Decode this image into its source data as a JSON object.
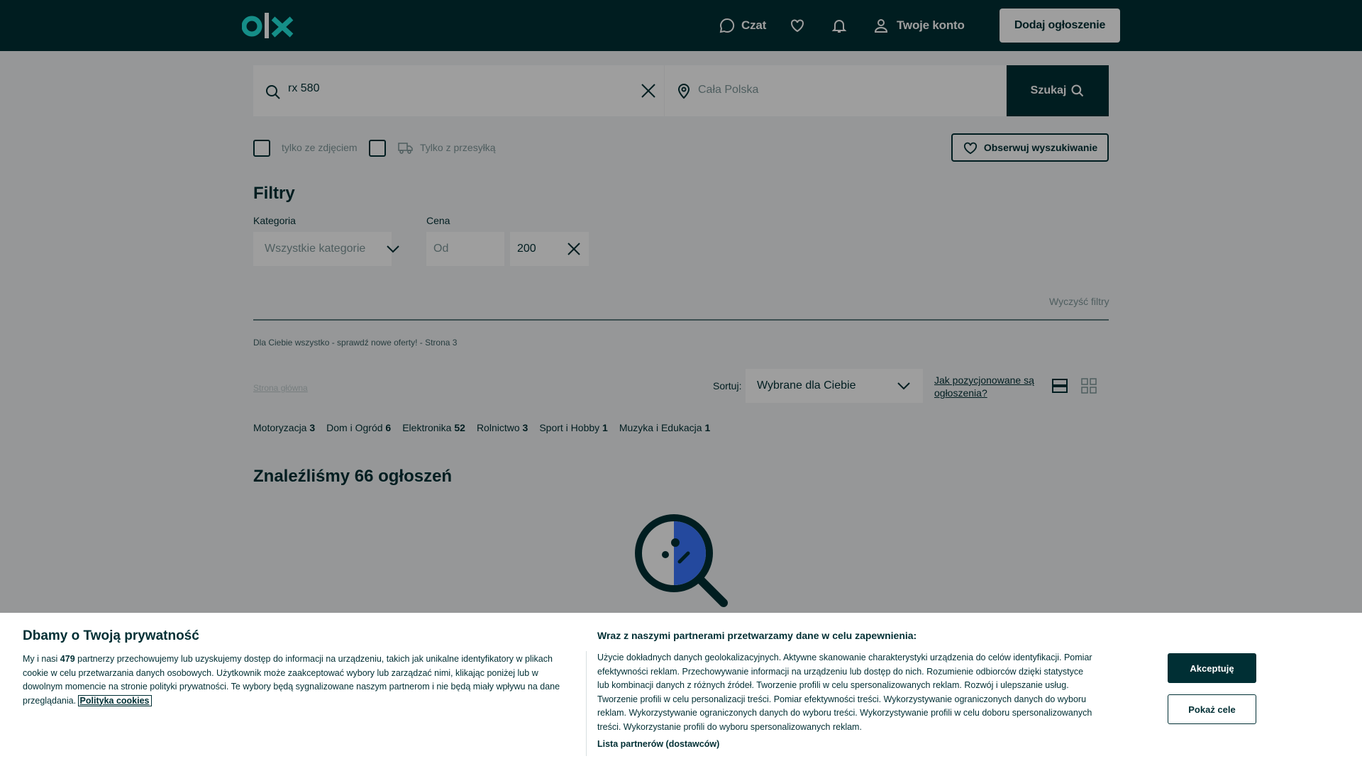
{
  "header": {
    "chat_label": "Czat",
    "account_label": "Twoje konto",
    "add_button": "Dodaj ogłoszenie",
    "colors": {
      "brand": "#002f34",
      "accent": "#23e5db"
    }
  },
  "search": {
    "query": "rx 580",
    "location": "Cała Polska",
    "button": "Szukaj"
  },
  "checkboxes": {
    "photos_label": "tylko ze zdjęciem",
    "delivery_label": "Tylko z przesyłką"
  },
  "observe_button": "Obserwuj wyszukiwanie",
  "filters": {
    "title": "Filtry",
    "category_label": "Kategoria",
    "category_value": "Wszystkie kategorie",
    "price_label": "Cena",
    "price_from_placeholder": "Od",
    "price_to_value": "200",
    "clear": "Wyczyść filtry"
  },
  "breadcrumb": {
    "text": "Dla Ciebie wszystko - sprawdź nowe oferty! - Strona 3",
    "home": "Strona główna"
  },
  "sort": {
    "label": "Sortuj:",
    "value": "Wybrane dla Ciebie",
    "how_link": "Jak pozycjonowane są ogłoszenia?"
  },
  "categories": [
    {
      "name": "Motoryzacja",
      "count": "3"
    },
    {
      "name": "Dom i Ogród",
      "count": "6"
    },
    {
      "name": "Elektronika",
      "count": "52"
    },
    {
      "name": "Rolnictwo",
      "count": "3"
    },
    {
      "name": "Sport i Hobby",
      "count": "1"
    },
    {
      "name": "Muzyka i Edukacja",
      "count": "1"
    }
  ],
  "results_title": "Znaleźliśmy 66 ogłoszeń",
  "cookie": {
    "title": "Dbamy o Twoją prywatność",
    "text_pre": "My i nasi ",
    "partners_count": "479",
    "text_post": " partnerzy przechowujemy lub uzyskujemy dostęp do informacji na urządzeniu, takich jak unikalne identyfikatory w plikach cookie w celu przetwarzania danych osobowych. Użytkownik może zaakceptować wybory lub zarządzać nimi, klikając poniżej lub w dowolnym momencie na stronie polityki prywatności. Te wybory będą sygnalizowane naszym partnerom i nie będą miały wpływu na dane przeglądania. ",
    "policy_link": "Polityka cookies",
    "purposes_title": "Wraz z naszymi partnerami przetwarzamy dane w celu zapewnienia:",
    "purposes_text": "Użycie dokładnych danych geolokalizacyjnych. Aktywne skanowanie charakterystyki urządzenia do celów identyfikacji. Pomiar efektywności reklam. Przechowywanie informacji na urządzeniu lub dostęp do nich. Rozumienie odbiorców dzięki statystyce lub kombinacji danych z różnych źródeł. Tworzenie profili w celu spersonalizowanych reklam. Rozwój i ulepszanie usług. Tworzenie profili w celu personalizacji treści. Pomiar efektywności treści. Wykorzystywanie ograniczonych danych do wyboru reklam. Wykorzystywanie ograniczonych danych do wyboru treści. Wykorzystywanie profili w celu doboru spersonalizowanych treści. Wykorzystanie profili do wyboru spersonalizowanych reklam.",
    "partners_link": "Lista partnerów (dostawców)",
    "accept": "Akceptuję",
    "show_purposes": "Pokaż cele"
  }
}
